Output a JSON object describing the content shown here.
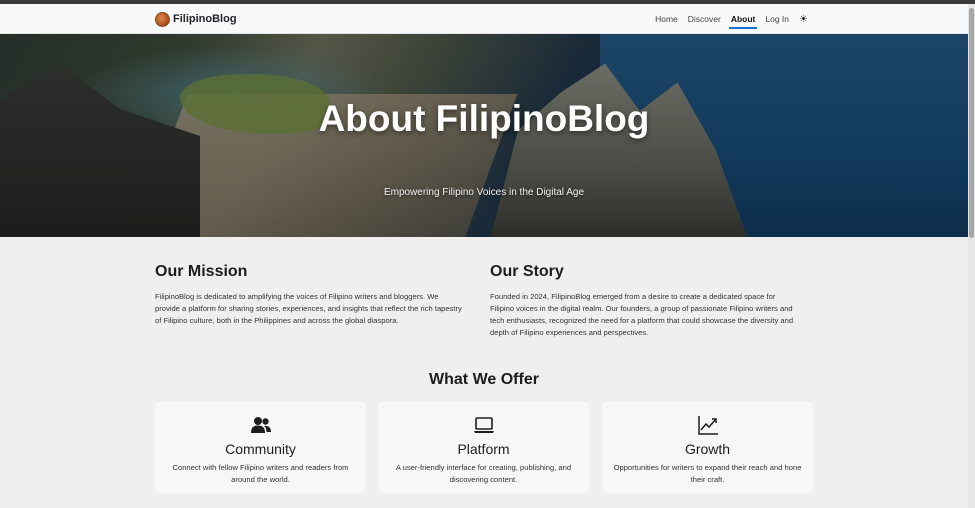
{
  "navbar": {
    "brand": "FilipinoBlog",
    "links": [
      {
        "label": "Home",
        "active": false
      },
      {
        "label": "Discover",
        "active": false
      },
      {
        "label": "About",
        "active": true
      },
      {
        "label": "Log In",
        "active": false
      }
    ],
    "theme_toggle_icon": "sun-icon"
  },
  "hero": {
    "title": "About FilipinoBlog",
    "subtitle": "Empowering Filipino Voices in the Digital Age"
  },
  "mission": {
    "heading": "Our Mission",
    "text": "FilipinoBlog is dedicated to amplifying the voices of Filipino writers and bloggers. We provide a platform for sharing stories, experiences, and insights that reflect the rich tapestry of Filipino culture, both in the Philippines and across the global diaspora."
  },
  "story": {
    "heading": "Our Story",
    "text": "Founded in 2024, FilipinoBlog emerged from a desire to create a dedicated space for Filipino voices in the digital realm. Our founders, a group of passionate Filipino writers and tech enthusiasts, recognized the need for a platform that could showcase the diversity and depth of Filipino experiences and perspectives."
  },
  "offer": {
    "heading": "What We Offer",
    "cards": [
      {
        "icon": "people-icon",
        "title": "Community",
        "text": "Connect with fellow Filipino writers and readers from around the world."
      },
      {
        "icon": "laptop-icon",
        "title": "Platform",
        "text": "A user-friendly interface for creating, publishing, and discovering content."
      },
      {
        "icon": "growth-chart-icon",
        "title": "Growth",
        "text": "Opportunities for writers to expand their reach and hone their craft."
      }
    ]
  }
}
